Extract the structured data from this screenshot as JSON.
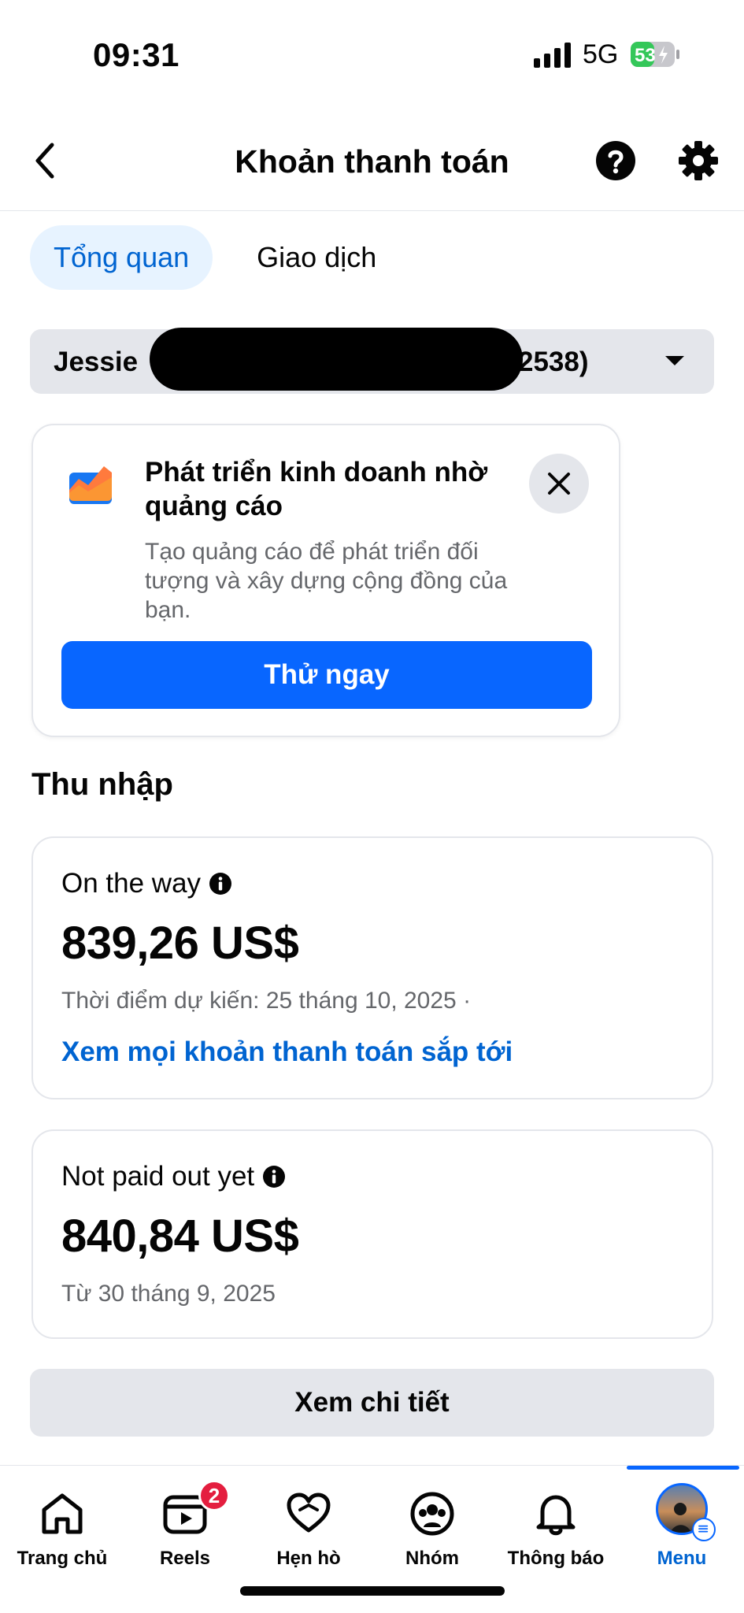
{
  "status_bar": {
    "time": "09:31",
    "network": "5G",
    "battery": "53"
  },
  "header": {
    "title": "Khoản thanh toán"
  },
  "tabs": [
    {
      "label": "Tổng quan",
      "active": true
    },
    {
      "label": "Giao dịch",
      "active": false
    }
  ],
  "account_select": {
    "name_visible": "Jessie",
    "suffix_visible": "2538)"
  },
  "promo": {
    "title": "Phát triển kinh doanh nhờ quảng cáo",
    "description": "Tạo quảng cáo để phát triển đối tượng và xây dựng cộng đồng của bạn.",
    "button_label": "Thử ngay"
  },
  "income": {
    "section_title": "Thu nhập",
    "on_the_way": {
      "label": "On the way",
      "amount": "839,26 US$",
      "expected": "Thời điểm dự kiến: 25 tháng 10, 2025 ·",
      "link": "Xem mọi khoản thanh toán sắp tới"
    },
    "not_paid": {
      "label": "Not paid out yet",
      "amount": "840,84 US$",
      "since": "Từ 30 tháng 9, 2025"
    },
    "details_button": "Xem chi tiết"
  },
  "nav": {
    "items": [
      {
        "label": "Trang chủ",
        "icon": "home-icon"
      },
      {
        "label": "Reels",
        "icon": "reels-icon",
        "badge": "2"
      },
      {
        "label": "Hẹn hò",
        "icon": "heart-icon"
      },
      {
        "label": "Nhóm",
        "icon": "groups-icon"
      },
      {
        "label": "Thông báo",
        "icon": "bell-icon"
      },
      {
        "label": "Menu",
        "icon": "avatar",
        "active": true
      }
    ]
  },
  "colors": {
    "accent": "#0866ff",
    "link": "#0064d1",
    "tab_active_bg": "#e7f3ff",
    "badge": "#e41e3f",
    "battery": "#34c759"
  }
}
